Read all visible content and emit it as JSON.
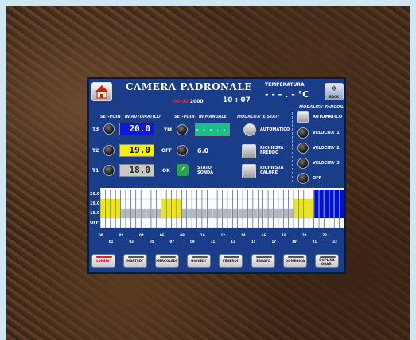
{
  "header": {
    "title": "CAMERA PADRONALE",
    "temp_label": "TEMPERATURA",
    "temp_value": "- - - . - °C",
    "date_red": "00 00",
    "year": "2000",
    "time": "10 : 07",
    "back_label": "BACK"
  },
  "sections": {
    "auto": "SET-POINT IN AUTOMATICO",
    "manual": "SET-POINT IN MANUALE",
    "modes": "MODALITA' E STATI",
    "fan": "MODALITA' FANCOIL"
  },
  "setpoints": [
    {
      "label": "T3",
      "value": "20.0"
    },
    {
      "label": "T2",
      "value": "19.0"
    },
    {
      "label": "T1",
      "value": "18.0"
    }
  ],
  "manual": {
    "tm_label": "TM",
    "tm_value": "- - - . -",
    "off_label": "OFF",
    "off_value": "6.0",
    "ok_label": "OK",
    "stato_label": "STATO SONDA"
  },
  "modes": {
    "automatico": "AUTOMATICO",
    "freddo": "RICHIESTA FREDDO",
    "calore": "RICHIESTA CALORE"
  },
  "fan": [
    "AUTOMATICO",
    "VELOCITA' 1",
    "VELOCITA' 2",
    "VELOCITA' 3",
    "OFF"
  ],
  "chart_data": {
    "type": "bar",
    "y_levels": [
      "20.0",
      "19.0",
      "18.0",
      "OFF"
    ],
    "hour_labels": [
      "00",
      "01",
      "02",
      "03",
      "04",
      "05",
      "06",
      "07",
      "08",
      "09",
      "10",
      "11",
      "12",
      "13",
      "14",
      "15",
      "16",
      "17",
      "18",
      "19",
      "20",
      "21",
      "22",
      "23"
    ],
    "half_hour_levels": [
      2,
      2,
      2,
      2,
      1,
      1,
      1,
      1,
      1,
      1,
      1,
      1,
      2,
      2,
      2,
      2,
      1,
      1,
      1,
      1,
      1,
      1,
      1,
      1,
      1,
      1,
      1,
      1,
      1,
      1,
      1,
      1,
      1,
      1,
      1,
      1,
      1,
      1,
      2,
      2,
      2,
      2,
      3,
      3,
      3,
      3,
      3,
      3
    ],
    "colors": {
      "T1": "#b7b7b7",
      "T2": "#f2e600",
      "T3": "#0010d8"
    }
  },
  "days": [
    "LUNEDI'",
    "MARTEDI'",
    "MERCOLEDI'",
    "GIOVEDI'",
    "VENERDI'",
    "SABATO",
    "DOMENICA",
    "DUPLICA ORARI"
  ]
}
